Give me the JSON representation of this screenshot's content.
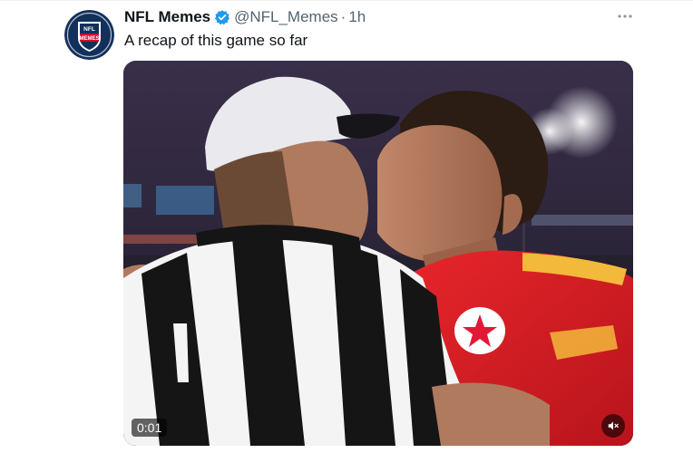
{
  "tweet": {
    "display_name": "NFL Memes",
    "handle": "@NFL_Memes",
    "separator": "·",
    "time": "1h",
    "text": "A recap of this game so far",
    "avatar_top": "NFL",
    "avatar_bottom": "MEMES",
    "verified_icon": "verified-badge-icon",
    "more_icon": "more-options-icon"
  },
  "media": {
    "type": "video",
    "timestamp": "0:01",
    "mute_icon": "muted-speaker-icon"
  },
  "colors": {
    "verified_blue": "#1d9bf0",
    "avatar_navy": "#13305c",
    "avatar_red": "#c8102e",
    "text_primary": "#0f1419",
    "text_secondary": "#536471"
  }
}
